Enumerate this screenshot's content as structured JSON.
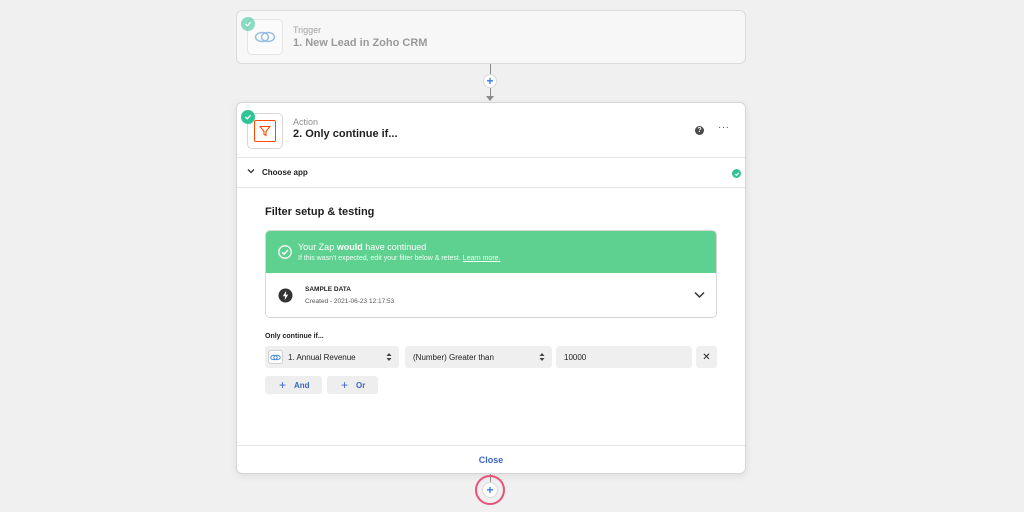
{
  "trigger": {
    "kind": "Trigger",
    "title": "1. New Lead in Zoho CRM",
    "app_icon": "zoho-crm-icon"
  },
  "action": {
    "kind": "Action",
    "title": "2. Only continue if...",
    "app_icon": "filter-icon",
    "help": "?",
    "more": "···",
    "section_label": "Choose app"
  },
  "filter": {
    "heading": "Filter setup & testing",
    "banner": {
      "prefix": "Your Zap ",
      "emphasis": "would",
      "suffix": " have continued",
      "sub_text": "If this wasn't expected, edit your filter below & retest. ",
      "link_text": "Learn more."
    },
    "sample": {
      "title": "SAMPLE DATA",
      "created": "Created - 2021-06-23 12:17:53"
    },
    "condition_label": "Only continue if...",
    "condition": {
      "field": "1. Annual Revenue",
      "operator": "(Number) Greater than",
      "value": "10000",
      "remove": "✕"
    },
    "and_label": "And",
    "or_label": "Or",
    "plus": "+"
  },
  "close_label": "Close",
  "colors": {
    "accent": "#3a66c9",
    "success": "#5ed08f",
    "check": "#2fc495",
    "highlight": "#e8527a"
  }
}
